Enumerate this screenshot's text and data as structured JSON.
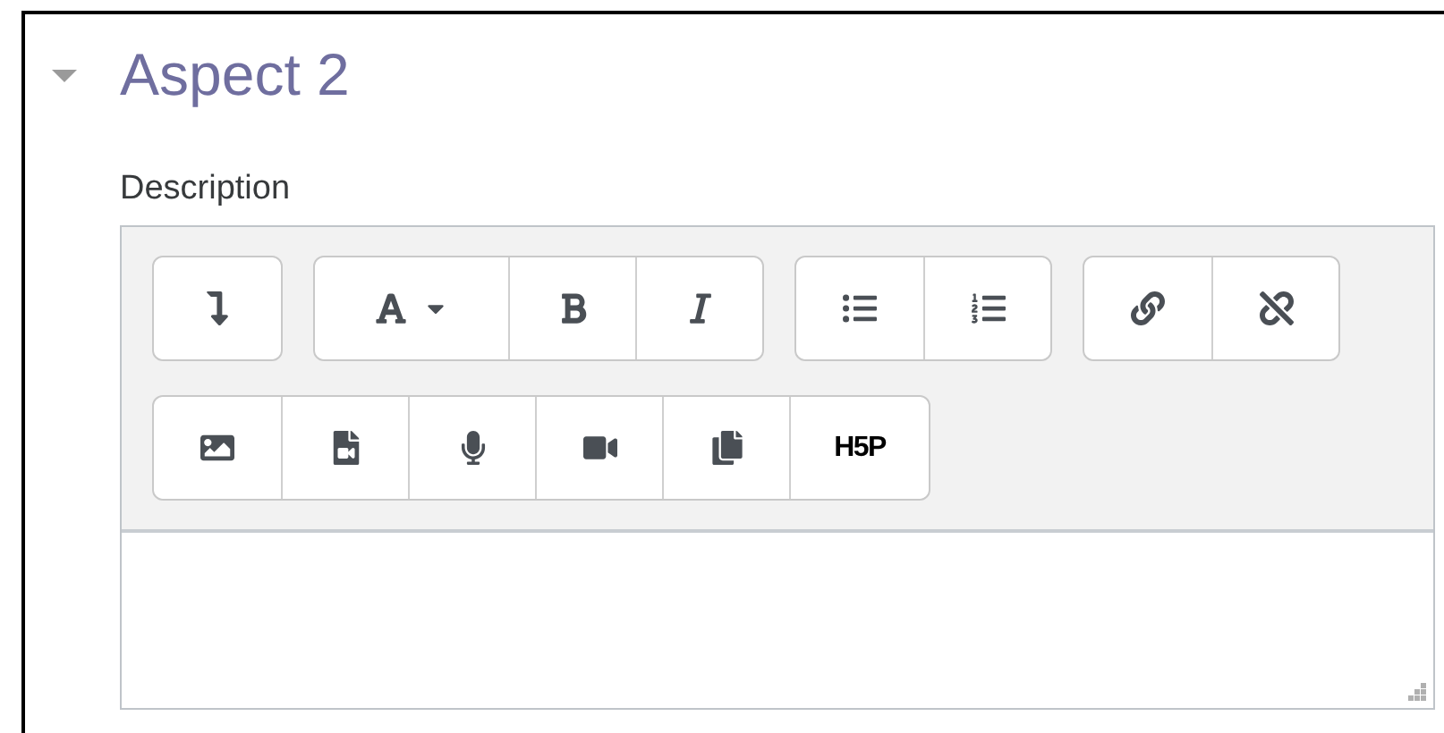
{
  "section": {
    "title": "Aspect 2",
    "expanded": true
  },
  "field": {
    "label": "Description"
  },
  "toolbar": {
    "rows": [
      {
        "groups": [
          {
            "buttons": [
              {
                "kind": "icon"
              }
            ]
          },
          {
            "buttons": [
              {
                "kind": "icon"
              },
              {
                "kind": "icon"
              },
              {
                "kind": "icon"
              }
            ]
          },
          {
            "buttons": [
              {
                "kind": "icon"
              },
              {
                "kind": "icon"
              }
            ]
          },
          {
            "buttons": [
              {
                "kind": "icon"
              },
              {
                "kind": "icon"
              }
            ]
          }
        ]
      },
      {
        "groups": [
          {
            "buttons": [
              {
                "kind": "icon"
              },
              {
                "kind": "icon"
              },
              {
                "kind": "icon"
              },
              {
                "kind": "icon"
              },
              {
                "kind": "icon"
              },
              {
                "kind": "label",
                "label": "H5P"
              }
            ]
          }
        ]
      }
    ]
  }
}
